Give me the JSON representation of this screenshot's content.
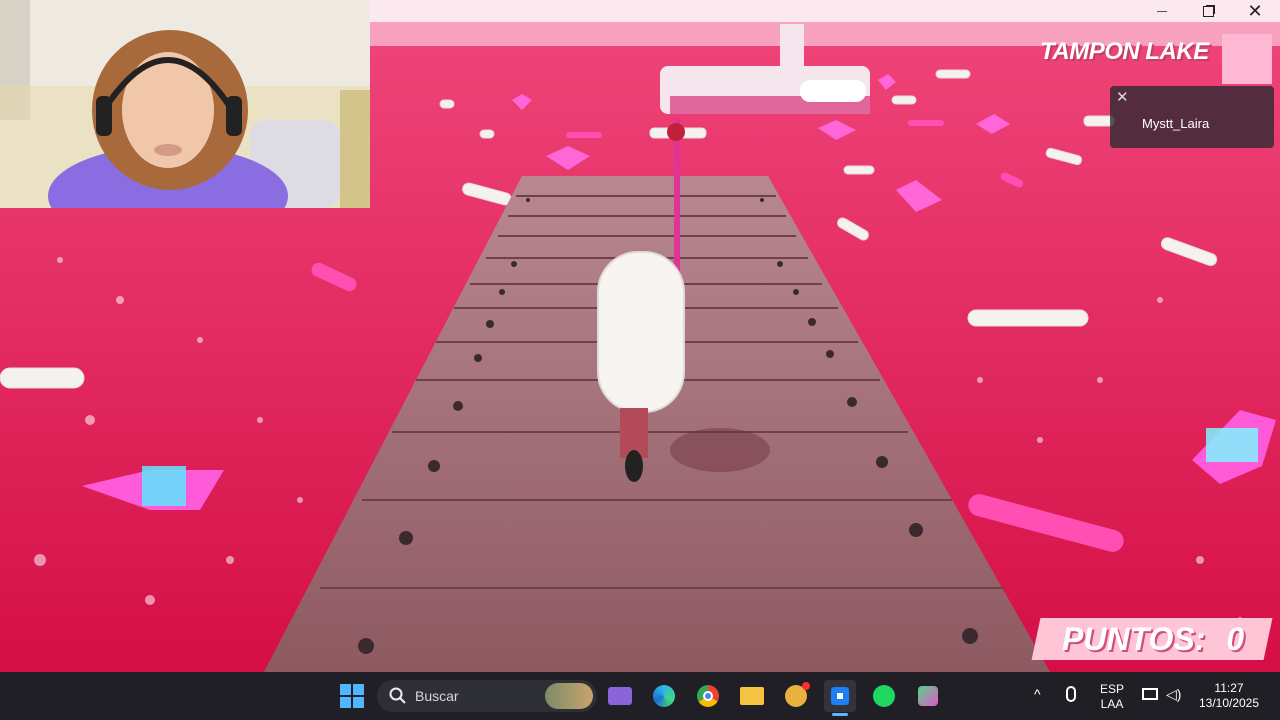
{
  "game": {
    "location_title": "TAMPON LAKE",
    "player_notification": {
      "username": "Mystt_Laira"
    },
    "score": {
      "label": "PUNTOS:",
      "value": "0"
    }
  },
  "window": {
    "minimize_icon": "minimize-icon",
    "restore_icon": "restore-icon",
    "close_icon": "close-icon"
  },
  "taskbar": {
    "search_placeholder": "Buscar",
    "language_top": "ESP",
    "language_bottom": "LAA",
    "time": "11:27",
    "date": "13/10/2025"
  },
  "colors": {
    "water": "#d8124a",
    "dock_wood": "#a8707a",
    "score_bg": "#ffc4d6",
    "taskbar": "#1f1f25"
  }
}
